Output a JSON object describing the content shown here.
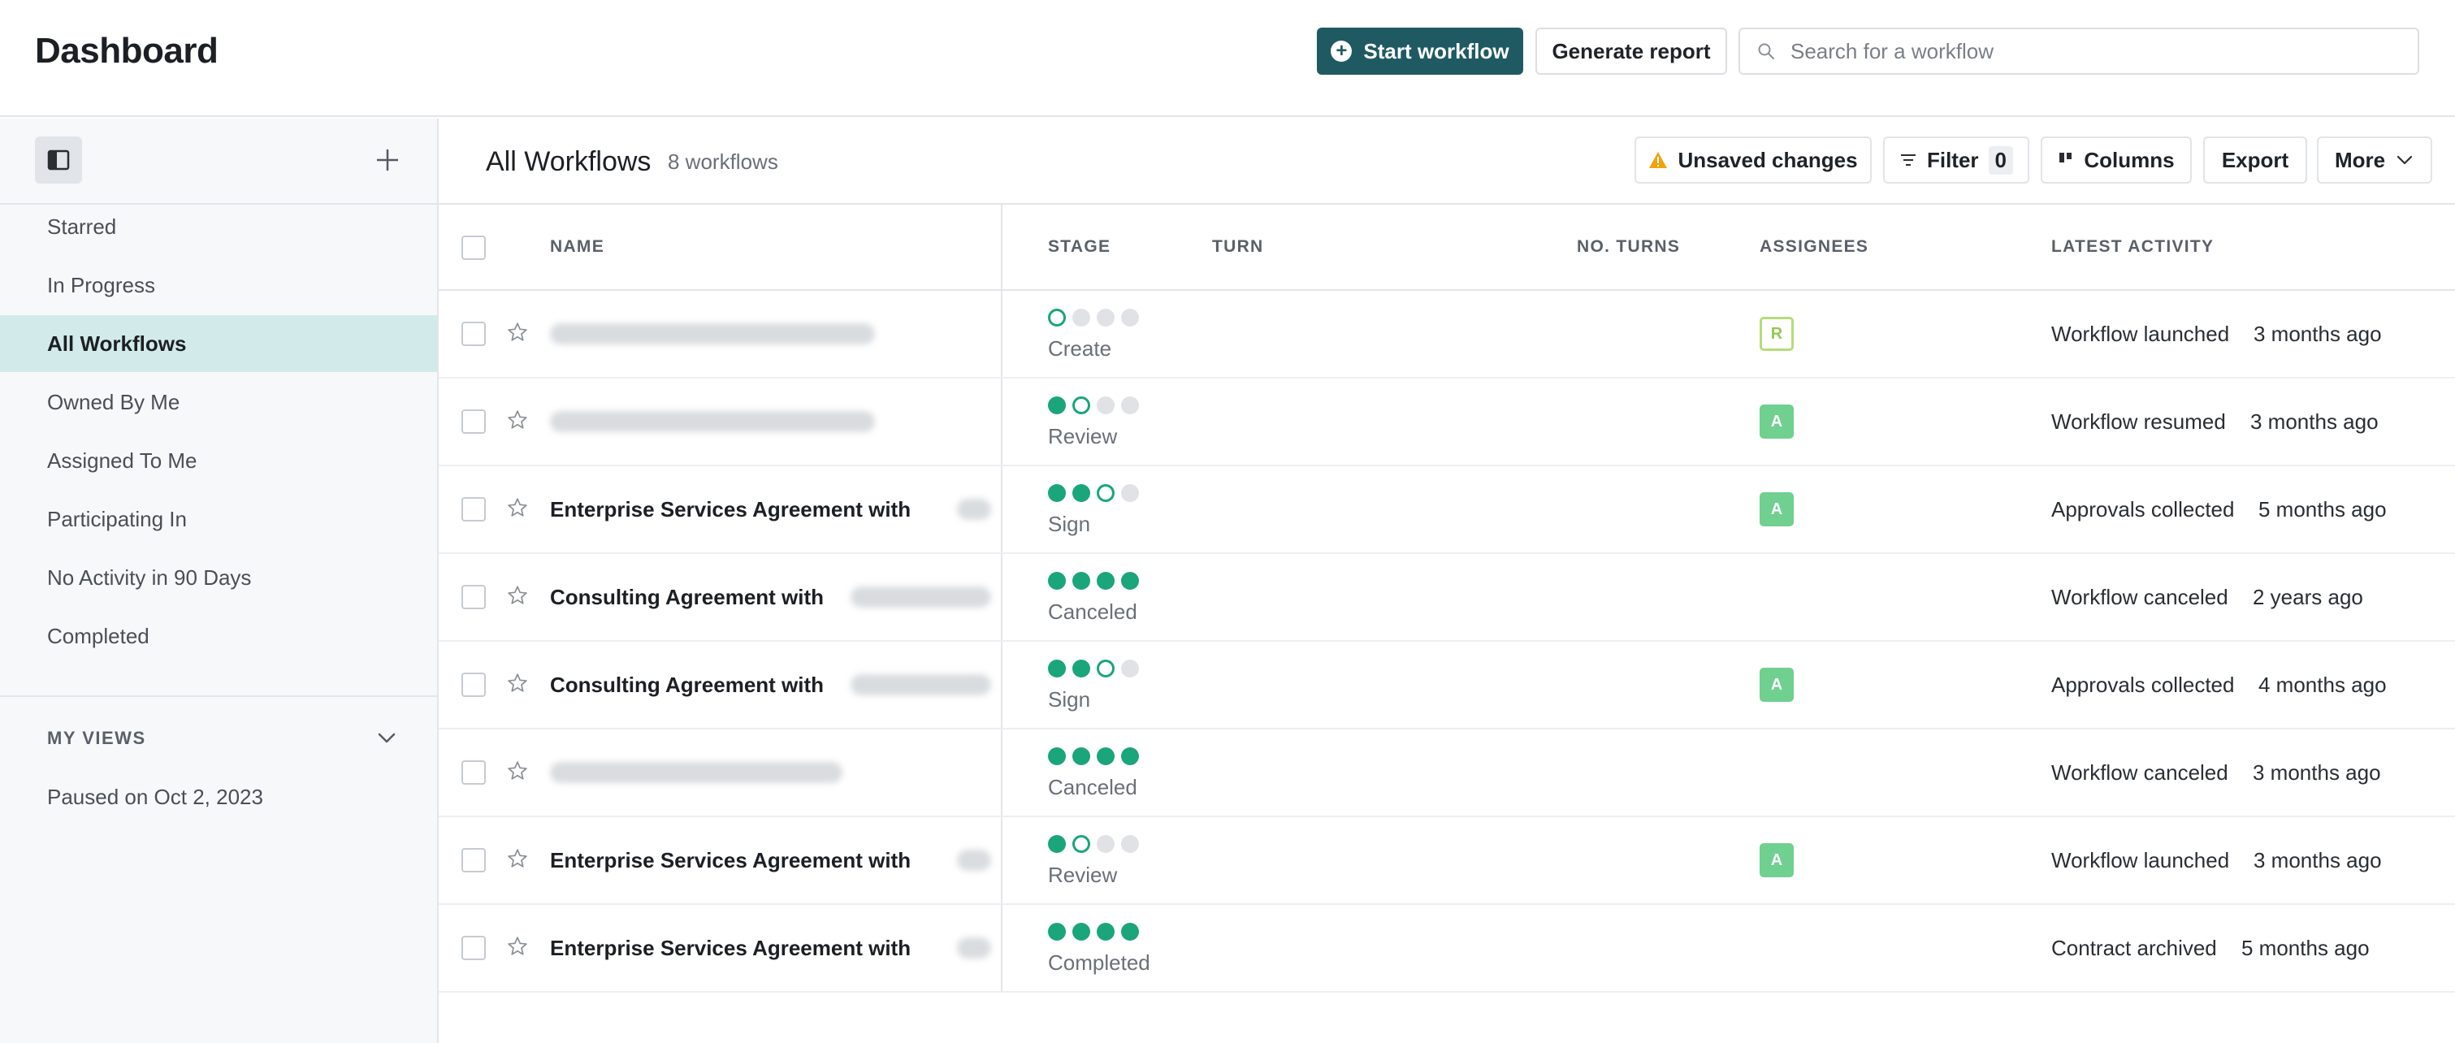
{
  "header": {
    "title": "Dashboard",
    "start_workflow_label": "Start workflow",
    "generate_report_label": "Generate report",
    "search_placeholder": "Search for a workflow"
  },
  "sidebar": {
    "items": [
      {
        "label": "Starred",
        "active": false
      },
      {
        "label": "In Progress",
        "active": false
      },
      {
        "label": "All Workflows",
        "active": true
      },
      {
        "label": "Owned By Me",
        "active": false
      },
      {
        "label": "Assigned To Me",
        "active": false
      },
      {
        "label": "Participating In",
        "active": false
      },
      {
        "label": "No Activity in 90 Days",
        "active": false
      },
      {
        "label": "Completed",
        "active": false
      }
    ],
    "my_views_heading": "MY VIEWS",
    "views": [
      {
        "label": "Paused on Oct 2, 2023"
      }
    ]
  },
  "main": {
    "title": "All Workflows",
    "count": "8 workflows",
    "unsaved_label": "Unsaved changes",
    "filter_label": "Filter",
    "filter_count": "0",
    "columns_label": "Columns",
    "export_label": "Export",
    "more_label": "More"
  },
  "table": {
    "headers": {
      "name": "NAME",
      "stage": "STAGE",
      "turn": "TURN",
      "no_turns": "NO. TURNS",
      "assignees": "ASSIGNEES",
      "latest_activity": "LATEST ACTIVITY"
    },
    "rows": [
      {
        "name": "",
        "stage_label": "Create",
        "stage_progress": [
          "current",
          "todo",
          "todo",
          "todo"
        ],
        "assignee": "R",
        "assignee_style": "outline",
        "activity": "Workflow launched",
        "activity_time": "3 months ago"
      },
      {
        "name": "",
        "stage_label": "Review",
        "stage_progress": [
          "done",
          "current",
          "todo",
          "todo"
        ],
        "assignee": "A",
        "assignee_style": "filled",
        "activity": "Workflow resumed",
        "activity_time": "3 months ago"
      },
      {
        "name": "Enterprise Services Agreement with",
        "stage_label": "Sign",
        "stage_progress": [
          "done",
          "done",
          "current",
          "todo"
        ],
        "assignee": "A",
        "assignee_style": "filled",
        "activity": "Approvals collected",
        "activity_time": "5 months ago"
      },
      {
        "name": "Consulting Agreement with",
        "stage_label": "Canceled",
        "stage_progress": [
          "done",
          "done",
          "done",
          "done"
        ],
        "assignee": "",
        "assignee_style": "",
        "activity": "Workflow canceled",
        "activity_time": "2 years ago"
      },
      {
        "name": "Consulting Agreement with",
        "stage_label": "Sign",
        "stage_progress": [
          "done",
          "done",
          "current",
          "todo"
        ],
        "assignee": "A",
        "assignee_style": "filled",
        "activity": "Approvals collected",
        "activity_time": "4 months ago"
      },
      {
        "name": "",
        "stage_label": "Canceled",
        "stage_progress": [
          "done",
          "done",
          "done",
          "done"
        ],
        "assignee": "",
        "assignee_style": "",
        "activity": "Workflow canceled",
        "activity_time": "3 months ago"
      },
      {
        "name": "Enterprise Services Agreement with",
        "stage_label": "Review",
        "stage_progress": [
          "done",
          "current",
          "todo",
          "todo"
        ],
        "assignee": "A",
        "assignee_style": "filled",
        "activity": "Workflow launched",
        "activity_time": "3 months ago"
      },
      {
        "name": "Enterprise Services Agreement with",
        "stage_label": "Completed",
        "stage_progress": [
          "done",
          "done",
          "done",
          "done"
        ],
        "assignee": "",
        "assignee_style": "",
        "activity": "Contract archived",
        "activity_time": "5 months ago"
      }
    ]
  },
  "colors": {
    "primary": "#1f5a63",
    "stage_done": "#1aa57a",
    "sidebar_active": "#d2ebea",
    "warning": "#f0a30a",
    "assignee_filled": "#6fd08f"
  },
  "icons": {
    "star": "star-icon",
    "search": "search-icon",
    "panel_toggle": "sidebar-panel-icon",
    "warning": "warning-icon",
    "filter": "filter-icon",
    "columns": "columns-icon",
    "chevron": "chevron-down-icon"
  }
}
